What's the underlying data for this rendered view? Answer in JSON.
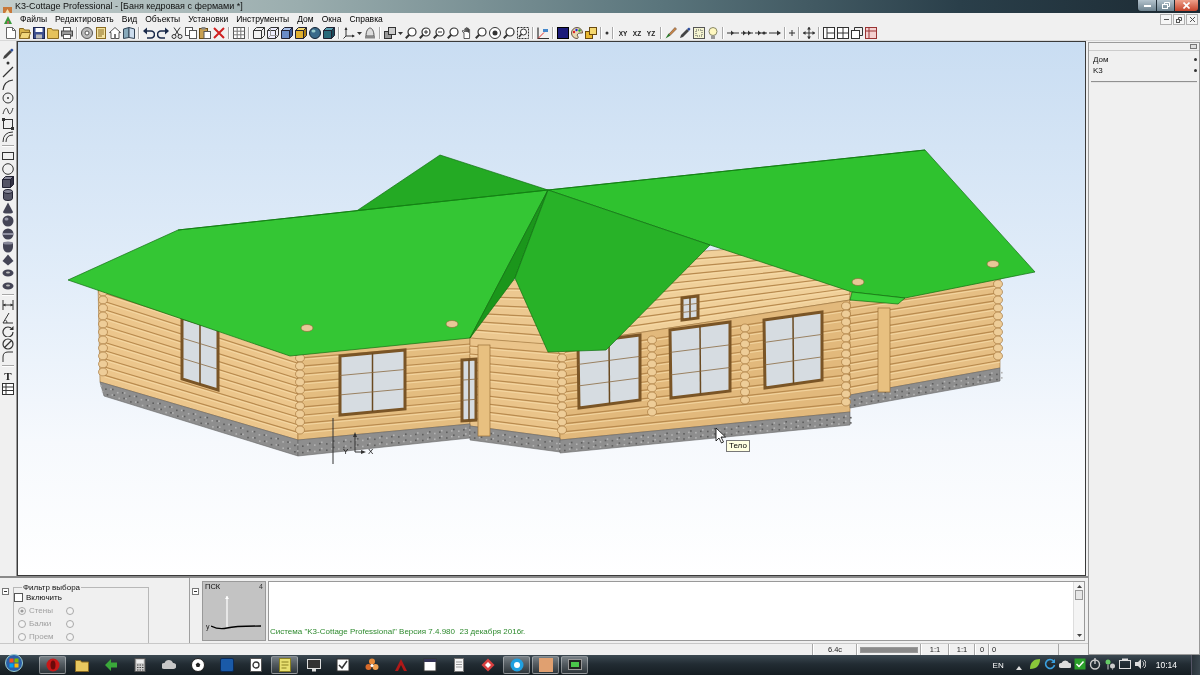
{
  "window": {
    "title": "K3-Cottage Professional - [Баня кедровая с фермами *]"
  },
  "menu": [
    "Файлы",
    "Редактировать",
    "Вид",
    "Объекты",
    "Установки",
    "Инструменты",
    "Дом",
    "Окна",
    "Справка"
  ],
  "toolbar": {
    "view_buttons": [
      "XY",
      "XZ",
      "YZ"
    ]
  },
  "tools": {
    "text_tool": "T"
  },
  "viewport": {
    "axis_labels": [
      "Y",
      "X"
    ],
    "tooltip": "Тело"
  },
  "tree": {
    "items": [
      "Дом",
      "K3"
    ]
  },
  "selection_filter": {
    "title": "Фильтр выбора",
    "enable": {
      "label": "Включить",
      "checked": false
    },
    "options": [
      {
        "label": "Стены",
        "selected": true,
        "disabled": true
      },
      {
        "label": "Балки",
        "selected": false,
        "disabled": true
      },
      {
        "label": "Проем",
        "selected": false,
        "disabled": true
      }
    ],
    "more_options": [
      {
        "selected": false,
        "disabled": true
      },
      {
        "selected": false,
        "disabled": true
      },
      {
        "selected": false,
        "disabled": true
      }
    ]
  },
  "ucs_panel": {
    "title": "ПСК",
    "badge": "4",
    "axis_label": "y"
  },
  "messages": [
    "Система \"K3-Cottage Professional\" Версия 7.4.980  23 декабря 2016г."
  ],
  "status_bar": {
    "items": [
      {
        "kind": "text",
        "text": "6.4с"
      },
      {
        "kind": "progress",
        "level": 1
      },
      {
        "kind": "text",
        "text": "1:1"
      },
      {
        "kind": "text",
        "text": "1:1"
      },
      {
        "kind": "text",
        "text": "0"
      },
      {
        "kind": "text",
        "text": "0"
      }
    ]
  },
  "taskbar": {
    "apps": [
      {
        "running": true
      },
      {
        "running": false
      },
      {
        "running": false
      },
      {
        "running": false
      },
      {
        "running": false
      },
      {
        "running": false
      },
      {
        "running": false
      },
      {
        "running": false
      },
      {
        "running": true
      },
      {
        "running": false
      },
      {
        "running": false
      },
      {
        "running": false
      },
      {
        "running": false
      },
      {
        "running": false
      },
      {
        "running": false
      },
      {
        "running": false
      },
      {
        "running": true
      },
      {
        "running": true
      },
      {
        "running": true
      }
    ],
    "language": "EN",
    "clock": "10:14"
  }
}
